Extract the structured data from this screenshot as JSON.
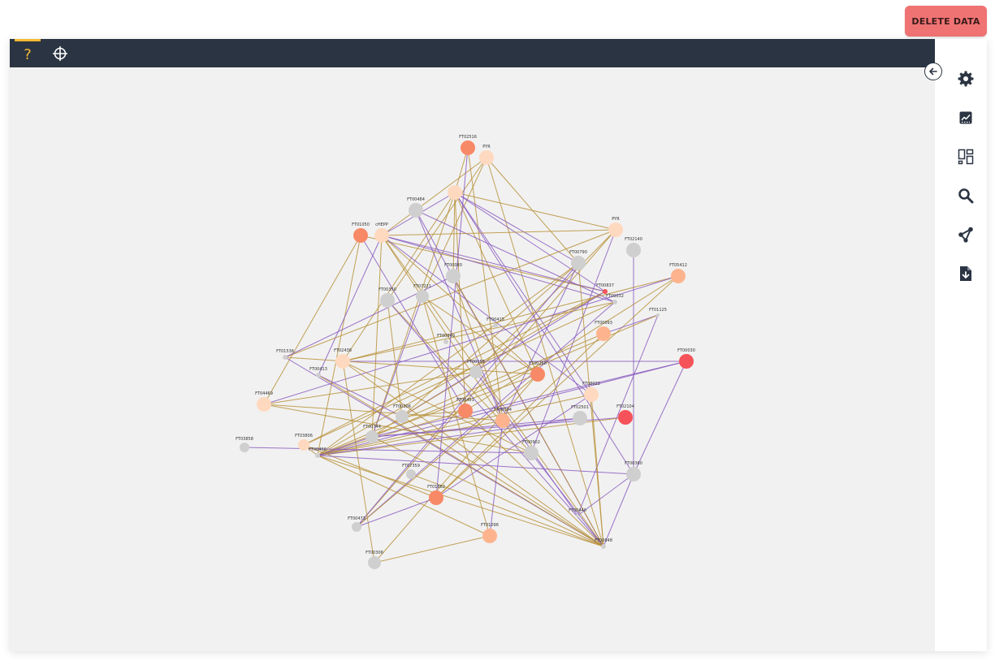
{
  "header": {
    "delete_label": "DELETE DATA"
  },
  "toolbar": {
    "help_label": "?"
  },
  "colors": {
    "toolbar_bg": "#2b3442",
    "accent": "#f5b833",
    "delete_bg": "#f07373",
    "edge_gold": "#b8923a",
    "edge_purple": "#8a5cc0",
    "node_grey": "#cfcfcf",
    "node_pale": "#ffd9bf",
    "node_light": "#fdb48e",
    "node_orange": "#f88966",
    "node_red": "#f5525a"
  },
  "sidebar": {
    "icons": [
      "gear-icon",
      "chart-icon",
      "layout-icon",
      "search-icon",
      "share-icon",
      "download-file-icon"
    ]
  },
  "graph": {
    "nodes": [
      {
        "id": "FT02516",
        "label": "FT02516",
        "color": "#f88966"
      },
      {
        "id": "PYR1",
        "label": "PYR",
        "color": "#ffd9bf"
      },
      {
        "id": "N_top",
        "label": "",
        "color": "#ffd9bf"
      },
      {
        "id": "FT00484",
        "label": "FT00484",
        "color": "#cfcfcf"
      },
      {
        "id": "FT01050",
        "label": "FT01050",
        "color": "#f88966"
      },
      {
        "id": "cHEPP",
        "label": "cHEPP",
        "color": "#ffd9bf"
      },
      {
        "id": "PYR2",
        "label": "PYR",
        "color": "#ffd9bf"
      },
      {
        "id": "FT02140",
        "label": "FT02140",
        "color": "#cfcfcf"
      },
      {
        "id": "FT00790",
        "label": "FT00790",
        "color": "#cfcfcf"
      },
      {
        "id": "FT05412",
        "label": "FT05412",
        "color": "#fdb48e"
      },
      {
        "id": "FT01125",
        "label": "FT01125",
        "color": "#cfcfcf"
      },
      {
        "id": "FT00350",
        "label": "FT00350",
        "color": "#cfcfcf"
      },
      {
        "id": "FT07221",
        "label": "FT07221",
        "color": "#cfcfcf"
      },
      {
        "id": "FT00837",
        "label": "FT00837",
        "color": "#f5525a"
      },
      {
        "id": "FT00032",
        "label": "FT00032",
        "color": "#cfcfcf"
      },
      {
        "id": "FT00080",
        "label": "FT00080",
        "color": "#cfcfcf"
      },
      {
        "id": "FT01123",
        "label": "FT01123",
        "color": "#cfcfcf"
      },
      {
        "id": "FT00415",
        "label": "FT00415",
        "color": "#cfcfcf"
      },
      {
        "id": "FT00940",
        "label": "FT00940",
        "color": "#cfcfcf"
      },
      {
        "id": "FT00093",
        "label": "FT00093",
        "color": "#fdb48e"
      },
      {
        "id": "FT00030",
        "label": "FT00030",
        "color": "#f5525a"
      },
      {
        "id": "FT01536",
        "label": "FT01536",
        "color": "#cfcfcf"
      },
      {
        "id": "FT02438",
        "label": "FT02438",
        "color": "#ffd9bf"
      },
      {
        "id": "FT00413",
        "label": "FT00413",
        "color": "#cfcfcf"
      },
      {
        "id": "FT00155",
        "label": "FT00155",
        "color": "#cfcfcf"
      },
      {
        "id": "FT00268",
        "label": "FT00268",
        "color": "#f88966"
      },
      {
        "id": "FT04469",
        "label": "FT04469",
        "color": "#ffd9bf"
      },
      {
        "id": "FT08022",
        "label": "FT08022",
        "color": "#ffd9bf"
      },
      {
        "id": "FT00451",
        "label": "FT00451",
        "color": "#f88966"
      },
      {
        "id": "FT02104",
        "label": "FT02104",
        "color": "#f5525a"
      },
      {
        "id": "FT00306",
        "label": "FT00306",
        "color": "#cfcfcf"
      },
      {
        "id": "FT00094",
        "label": "FT00094",
        "color": "#fdb48e"
      },
      {
        "id": "FT02501",
        "label": "FT02501",
        "color": "#cfcfcf"
      },
      {
        "id": "FT00744",
        "label": "FT00744",
        "color": "#cfcfcf"
      },
      {
        "id": "FT03858",
        "label": "FT03858",
        "color": "#cfcfcf"
      },
      {
        "id": "FT03806",
        "label": "FT03806",
        "color": "#ffd9bf"
      },
      {
        "id": "FT00466",
        "label": "FT00466",
        "color": "#cfcfcf"
      },
      {
        "id": "FT00902",
        "label": "FT00902",
        "color": "#cfcfcf"
      },
      {
        "id": "FT07359",
        "label": "FT07359",
        "color": "#cfcfcf"
      },
      {
        "id": "FT00360",
        "label": "FT00360",
        "color": "#cfcfcf"
      },
      {
        "id": "FT01862",
        "label": "FT01862",
        "color": "#f88966"
      },
      {
        "id": "FT00440",
        "label": "FT00440",
        "color": "#cfcfcf"
      },
      {
        "id": "FT00473",
        "label": "FT00473",
        "color": "#cfcfcf"
      },
      {
        "id": "FT01096",
        "label": "FT01096",
        "color": "#fdb48e"
      },
      {
        "id": "FT00848",
        "label": "FT00848",
        "color": "#cfcfcf"
      },
      {
        "id": "FT00306b",
        "label": "FT00306",
        "color": "#cfcfcf"
      }
    ],
    "edges": [
      [
        "FT02516",
        "FT00094",
        "g"
      ],
      [
        "FT02516",
        "N_top",
        "g"
      ],
      [
        "PYR1",
        "FT00848",
        "g"
      ],
      [
        "PYR1",
        "FT00350",
        "g"
      ],
      [
        "PYR1",
        "cHEPP",
        "g"
      ],
      [
        "PYR1",
        "FT00790",
        "g"
      ],
      [
        "PYR1",
        "FT07221",
        "g"
      ],
      [
        "N_top",
        "FT00790",
        "p"
      ],
      [
        "N_top",
        "FT00837",
        "p"
      ],
      [
        "N_top",
        "FT00451",
        "g"
      ],
      [
        "N_top",
        "FT00268",
        "g"
      ],
      [
        "N_top",
        "FT02438",
        "g"
      ],
      [
        "N_top",
        "FT00360",
        "p"
      ],
      [
        "N_top",
        "cHEPP",
        "p"
      ],
      [
        "N_top",
        "FT00744",
        "g"
      ],
      [
        "N_top",
        "FT00080",
        "g"
      ],
      [
        "N_top",
        "FT08022",
        "p"
      ],
      [
        "N_top",
        "PYR2",
        "g"
      ],
      [
        "FT00484",
        "FT00094",
        "p"
      ],
      [
        "FT00484",
        "FT00848",
        "p"
      ],
      [
        "FT00484",
        "FT00032",
        "p"
      ],
      [
        "FT01050",
        "FT00466",
        "g"
      ],
      [
        "FT01050",
        "FT04469",
        "g"
      ],
      [
        "FT01050",
        "FT00451",
        "p"
      ],
      [
        "FT01050",
        "FT00837",
        "g"
      ],
      [
        "cHEPP",
        "FT00837",
        "p"
      ],
      [
        "cHEPP",
        "FT00032",
        "p"
      ],
      [
        "cHEPP",
        "FT00268",
        "g"
      ],
      [
        "cHEPP",
        "FT00094",
        "g"
      ],
      [
        "cHEPP",
        "FT08022",
        "p"
      ],
      [
        "cHEPP",
        "FT00744",
        "g"
      ],
      [
        "cHEPP",
        "FT00848",
        "g"
      ],
      [
        "cHEPP",
        "FT00413",
        "p"
      ],
      [
        "cHEPP",
        "PYR2",
        "g"
      ],
      [
        "PYR2",
        "FT01536",
        "g"
      ],
      [
        "PYR2",
        "FT00473",
        "g"
      ],
      [
        "PYR2",
        "FT00155",
        "g"
      ],
      [
        "PYR2",
        "FT00902",
        "p"
      ],
      [
        "FT02140",
        "FT00360",
        "p"
      ],
      [
        "FT00790",
        "FT00466",
        "g"
      ],
      [
        "FT00790",
        "FT00473",
        "p"
      ],
      [
        "FT00790",
        "FT00848",
        "g"
      ],
      [
        "FT00790",
        "FT00094",
        "p"
      ],
      [
        "FT00790",
        "FT00306",
        "g"
      ],
      [
        "FT05412",
        "FT01862",
        "g"
      ],
      [
        "FT05412",
        "FT02438",
        "g"
      ],
      [
        "FT05412",
        "FT00451",
        "g"
      ],
      [
        "FT05412",
        "FT04469",
        "p"
      ],
      [
        "FT01125",
        "FT00440",
        "p"
      ],
      [
        "FT01125",
        "FT00093",
        "p"
      ],
      [
        "FT01125",
        "FT00744",
        "g"
      ],
      [
        "FT00350",
        "FT00902",
        "g"
      ],
      [
        "FT00350",
        "FT00848",
        "p"
      ],
      [
        "FT00350",
        "FT00306",
        "g"
      ],
      [
        "FT07221",
        "FT00268",
        "g"
      ],
      [
        "FT07221",
        "FT00744",
        "p"
      ],
      [
        "FT07221",
        "FT01096",
        "g"
      ],
      [
        "FT00837",
        "FT00466",
        "g"
      ],
      [
        "FT00837",
        "FT03806",
        "g"
      ],
      [
        "FT00837",
        "FT00306",
        "p"
      ],
      [
        "FT00032",
        "FT02438",
        "g"
      ],
      [
        "FT00032",
        "FT00473",
        "p"
      ],
      [
        "FT00032",
        "FT03806",
        "g"
      ],
      [
        "FT00080",
        "FT01536",
        "p"
      ],
      [
        "FT00080",
        "FT00848",
        "g"
      ],
      [
        "FT00080",
        "FT00094",
        "g"
      ],
      [
        "FT00093",
        "FT00466",
        "g"
      ],
      [
        "FT00093",
        "FT01862",
        "g"
      ],
      [
        "FT00030",
        "FT00466",
        "p"
      ],
      [
        "FT00030",
        "FT00744",
        "p"
      ],
      [
        "FT00030",
        "FT02438",
        "p"
      ],
      [
        "FT00030",
        "FT00360",
        "p"
      ],
      [
        "FT01536",
        "FT00848",
        "p"
      ],
      [
        "FT01536",
        "FT00268",
        "g"
      ],
      [
        "FT02438",
        "FT00848",
        "g"
      ],
      [
        "FT02438",
        "FT00902",
        "g"
      ],
      [
        "FT02438",
        "FT00306b",
        "g"
      ],
      [
        "FT00413",
        "FT00306",
        "p"
      ],
      [
        "FT00413",
        "FT00848",
        "g"
      ],
      [
        "FT00155",
        "FT00440",
        "p"
      ],
      [
        "FT00155",
        "FT00306",
        "g"
      ],
      [
        "FT00155",
        "FT04469",
        "g"
      ],
      [
        "FT00268",
        "FT00466",
        "g"
      ],
      [
        "FT00268",
        "FT00306b",
        "g"
      ],
      [
        "FT00268",
        "FT00473",
        "g"
      ],
      [
        "FT04469",
        "FT00902",
        "g"
      ],
      [
        "FT04469",
        "FT00094",
        "g"
      ],
      [
        "FT08022",
        "FT00466",
        "g"
      ],
      [
        "FT08022",
        "FT01862",
        "p"
      ],
      [
        "FT08022",
        "FT00848",
        "g"
      ],
      [
        "FT00451",
        "FT00848",
        "g"
      ],
      [
        "FT00451",
        "FT00466",
        "g"
      ],
      [
        "FT00451",
        "FT00306",
        "g"
      ],
      [
        "FT02104",
        "FT00744",
        "p"
      ],
      [
        "FT02104",
        "FT00466",
        "g"
      ],
      [
        "FT00306",
        "FT00744",
        "g"
      ],
      [
        "FT00306",
        "FT00848",
        "g"
      ],
      [
        "FT00094",
        "FT00466",
        "g"
      ],
      [
        "FT00094",
        "FT01096",
        "p"
      ],
      [
        "FT02501",
        "FT00466",
        "p"
      ],
      [
        "FT02501",
        "FT00744",
        "p"
      ],
      [
        "FT00744",
        "FT00466",
        "p"
      ],
      [
        "FT00744",
        "FT00848",
        "g"
      ],
      [
        "FT03858",
        "FT00902",
        "p"
      ],
      [
        "FT03806",
        "FT00466",
        "g"
      ],
      [
        "FT03806",
        "FT01862",
        "g"
      ],
      [
        "FT00466",
        "FT00360",
        "p"
      ],
      [
        "FT00466",
        "FT00848",
        "g"
      ],
      [
        "FT00466",
        "FT01096",
        "g"
      ],
      [
        "FT00902",
        "FT00848",
        "p"
      ],
      [
        "FT07359",
        "FT00848",
        "g"
      ],
      [
        "FT00360",
        "FT00848",
        "p"
      ],
      [
        "FT01862",
        "FT00473",
        "p"
      ],
      [
        "FT01862",
        "FT02516",
        "p"
      ],
      [
        "FT01096",
        "FT00306b",
        "g"
      ],
      [
        "FT00440",
        "FT00360",
        "p"
      ]
    ]
  }
}
